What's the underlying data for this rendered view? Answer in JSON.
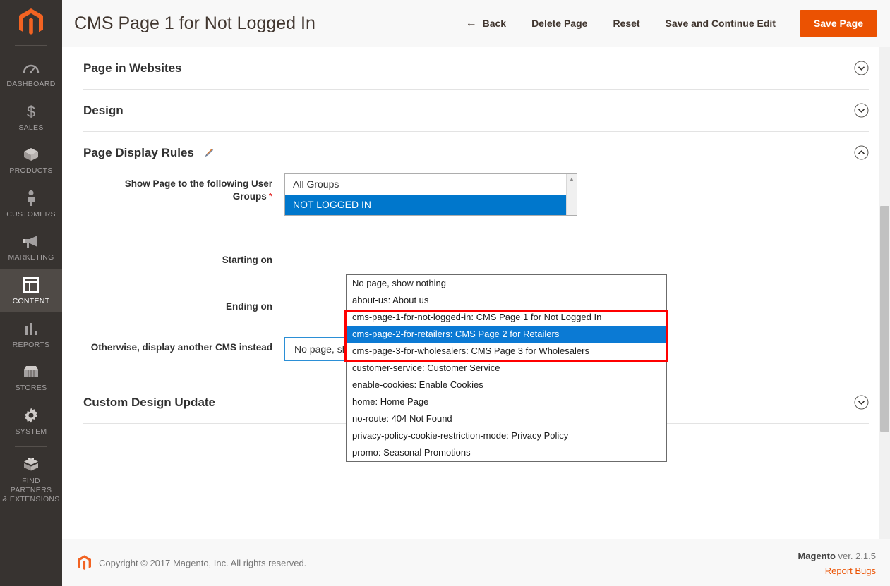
{
  "sidebar": {
    "logo": "magento-logo-icon",
    "items": [
      {
        "label": "DASHBOARD",
        "icon": "dashboard-gauge-icon",
        "active": false
      },
      {
        "label": "SALES",
        "icon": "dollar-sign-icon",
        "active": false
      },
      {
        "label": "PRODUCTS",
        "icon": "box-icon",
        "active": false
      },
      {
        "label": "CUSTOMERS",
        "icon": "person-icon",
        "active": false
      },
      {
        "label": "MARKETING",
        "icon": "megaphone-icon",
        "active": false
      },
      {
        "label": "CONTENT",
        "icon": "layout-panel-icon",
        "active": true
      },
      {
        "label": "REPORTS",
        "icon": "bar-chart-icon",
        "active": false
      },
      {
        "label": "STORES",
        "icon": "storefront-icon",
        "active": false
      },
      {
        "label": "SYSTEM",
        "icon": "gear-icon",
        "active": false
      },
      {
        "label": "FIND PARTNERS\n& EXTENSIONS",
        "icon": "extension-box-icon",
        "active": false
      }
    ]
  },
  "header": {
    "title": "CMS Page 1 for Not Logged In",
    "back_label": "Back",
    "back_icon": "arrow-left-icon",
    "delete_label": "Delete Page",
    "reset_label": "Reset",
    "save_continue_label": "Save and Continue Edit",
    "save_label": "Save Page",
    "primary_color": "#eb5202"
  },
  "sections": [
    {
      "title": "Page in Websites",
      "expanded": false,
      "icon": "chevron-down-icon"
    },
    {
      "title": "Design",
      "expanded": false,
      "icon": "chevron-down-icon"
    },
    {
      "title": "Page Display Rules",
      "expanded": true,
      "icon": "chevron-up-icon",
      "edit_icon": "pencil-icon"
    },
    {
      "title": "Custom Design Update",
      "expanded": false,
      "icon": "chevron-down-icon"
    }
  ],
  "form": {
    "user_groups": {
      "label": "Show Page to the following User Groups",
      "required_marker": "*",
      "options": [
        {
          "label": "All Groups",
          "selected": false
        },
        {
          "label": "NOT LOGGED IN",
          "selected": true
        }
      ],
      "scroll_icon": "scroll-up-arrow-icon"
    },
    "starting_on": {
      "label": "Starting on"
    },
    "ending_on": {
      "label": "Ending on"
    },
    "fallback_page": {
      "label": "Otherwise, display another CMS instead",
      "value": "No page, show nothing",
      "toggle_icon": "caret-up-icon"
    }
  },
  "dropdown": {
    "open": true,
    "highlight_color": "#0b7ad4",
    "annotation_color": "#ff0000",
    "options": [
      {
        "label": "No page, show nothing",
        "selected": false,
        "annotated": false
      },
      {
        "label": "about-us: About us",
        "selected": false,
        "annotated": false
      },
      {
        "label": "cms-page-1-for-not-logged-in: CMS Page 1 for Not Logged In",
        "selected": false,
        "annotated": true
      },
      {
        "label": "cms-page-2-for-retailers: CMS Page 2 for Retailers",
        "selected": true,
        "annotated": true
      },
      {
        "label": "cms-page-3-for-wholesalers: CMS Page 3 for Wholesalers",
        "selected": false,
        "annotated": true
      },
      {
        "label": "customer-service: Customer Service",
        "selected": false,
        "annotated": false
      },
      {
        "label": "enable-cookies: Enable Cookies",
        "selected": false,
        "annotated": false
      },
      {
        "label": "home: Home Page",
        "selected": false,
        "annotated": false
      },
      {
        "label": "no-route: 404 Not Found",
        "selected": false,
        "annotated": false
      },
      {
        "label": "privacy-policy-cookie-restriction-mode: Privacy Policy",
        "selected": false,
        "annotated": false
      },
      {
        "label": "promo: Seasonal Promotions",
        "selected": false,
        "annotated": false
      }
    ]
  },
  "footer": {
    "logo": "magento-logo-icon",
    "copyright": "Copyright © 2017 Magento, Inc. All rights reserved.",
    "brand": "Magento",
    "version": " ver. 2.1.5",
    "report_bugs": "Report Bugs"
  }
}
